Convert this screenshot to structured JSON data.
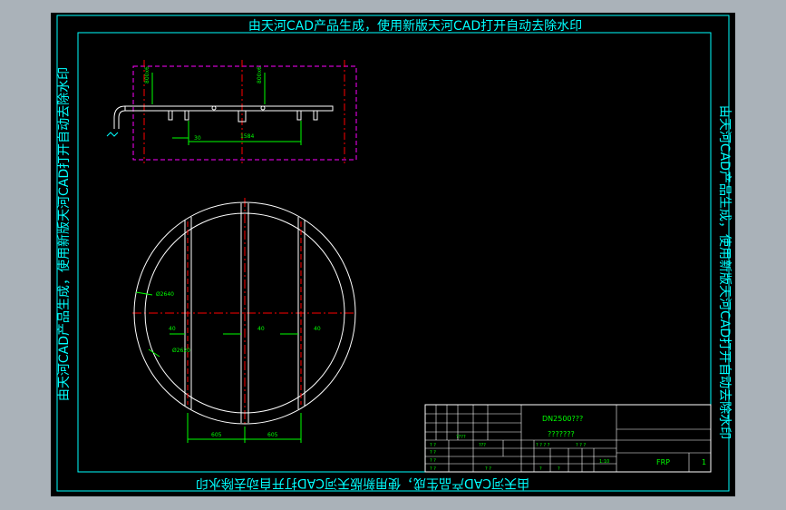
{
  "watermark": {
    "top": "由天河CAD产品生成，使用新版天河CAD打开自动去除水印",
    "bottom": "由天河CAD产品生成，使用新版天河CAD打开自动去除水印",
    "left": "由天河CAD产品生成，使用新版天河CAD打开自动去除水印",
    "right": "由天河CAD产品生成，使用新版天河CAD打开自动去除水印"
  },
  "elevation_view": {
    "dim_height_left": "800x6",
    "dim_height_right": "800x6",
    "dim_small": "30",
    "dim_long": "1584"
  },
  "plan_view": {
    "outer_diameter": "Ø2640",
    "inner_diameter": "Ø2620",
    "dim_left": "40",
    "dim_mid": "40",
    "dim_right": "40",
    "dim_bottom_left": "605",
    "dim_bottom_right": "605"
  },
  "title_block": {
    "drawing_name": "DN2500???",
    "drawing_sub": "???????",
    "material": "FRP",
    "quantity": "1",
    "scale": "1:10",
    "q_marks": [
      "? ?",
      "? ?",
      "????",
      "???",
      "? ? ? ?",
      "? ? ?",
      "? ?",
      "? ?",
      "? ?",
      "?",
      "?"
    ]
  },
  "colors": {
    "sheet_bg": "#000000",
    "frame": "#00ffff",
    "watermark": "#00ffff",
    "geometry": "#ffffff",
    "dimension": "#00ff00",
    "centerline": "#ff0000",
    "boundary": "#ff00ff"
  }
}
